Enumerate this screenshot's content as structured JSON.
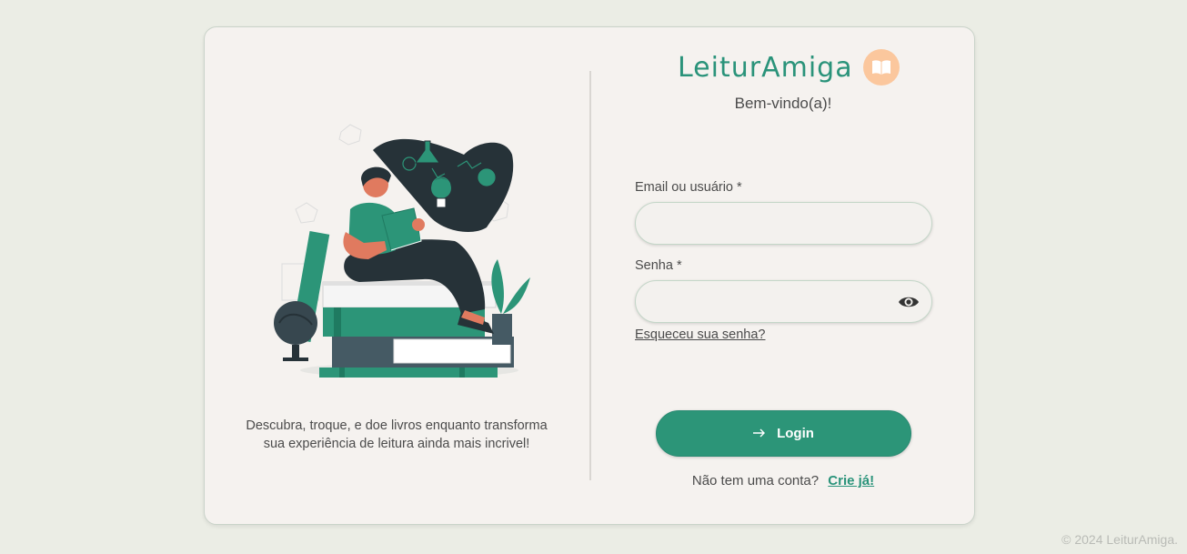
{
  "brand": {
    "name": "LeiturAmiga",
    "logo_icon": "book-open-icon",
    "logo_color": "#fbc79d",
    "accent": "#2a937a"
  },
  "welcome": "Bem-vindo(a)!",
  "tagline": "Descubra, troque, e doe livros enquanto transforma sua experiência de leitura ainda mais incrivel!",
  "form": {
    "email_label": "Email ou usuário *",
    "email_value": "",
    "password_label": "Senha *",
    "password_value": "",
    "password_toggle_icon": "eye-icon",
    "forgot_link": "Esqueceu sua senha?",
    "login_label": "Login",
    "login_icon": "arrow-right-icon"
  },
  "signup": {
    "prompt": "Não tem uma conta?",
    "link": "Crie já!"
  },
  "footer": "© 2024 LeiturAmiga."
}
